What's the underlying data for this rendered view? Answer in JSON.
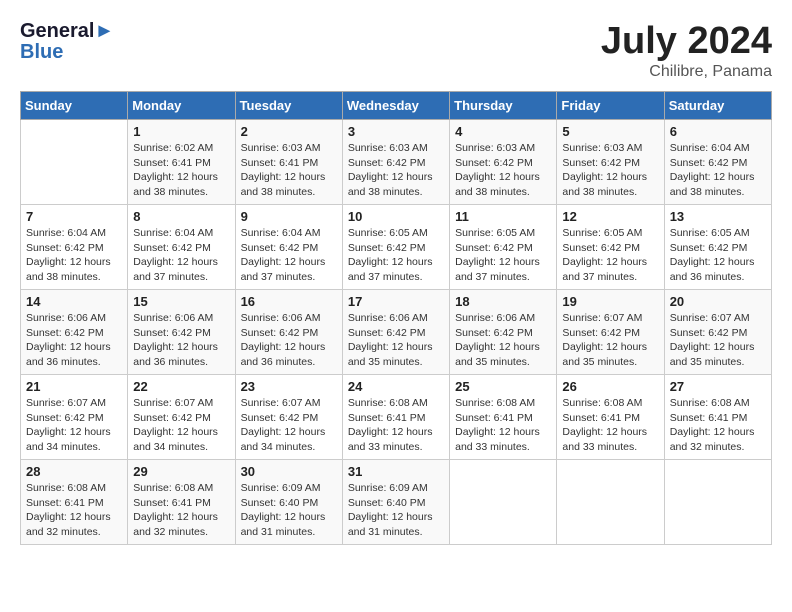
{
  "header": {
    "logo_line1": "General",
    "logo_line2": "Blue",
    "month": "July 2024",
    "location": "Chilibre, Panama"
  },
  "days_of_week": [
    "Sunday",
    "Monday",
    "Tuesday",
    "Wednesday",
    "Thursday",
    "Friday",
    "Saturday"
  ],
  "weeks": [
    [
      {
        "day": "",
        "sunrise": "",
        "sunset": "",
        "daylight": ""
      },
      {
        "day": "1",
        "sunrise": "6:02 AM",
        "sunset": "6:41 PM",
        "daylight": "12 hours and 38 minutes."
      },
      {
        "day": "2",
        "sunrise": "6:03 AM",
        "sunset": "6:41 PM",
        "daylight": "12 hours and 38 minutes."
      },
      {
        "day": "3",
        "sunrise": "6:03 AM",
        "sunset": "6:42 PM",
        "daylight": "12 hours and 38 minutes."
      },
      {
        "day": "4",
        "sunrise": "6:03 AM",
        "sunset": "6:42 PM",
        "daylight": "12 hours and 38 minutes."
      },
      {
        "day": "5",
        "sunrise": "6:03 AM",
        "sunset": "6:42 PM",
        "daylight": "12 hours and 38 minutes."
      },
      {
        "day": "6",
        "sunrise": "6:04 AM",
        "sunset": "6:42 PM",
        "daylight": "12 hours and 38 minutes."
      }
    ],
    [
      {
        "day": "7",
        "sunrise": "6:04 AM",
        "sunset": "6:42 PM",
        "daylight": "12 hours and 38 minutes."
      },
      {
        "day": "8",
        "sunrise": "6:04 AM",
        "sunset": "6:42 PM",
        "daylight": "12 hours and 37 minutes."
      },
      {
        "day": "9",
        "sunrise": "6:04 AM",
        "sunset": "6:42 PM",
        "daylight": "12 hours and 37 minutes."
      },
      {
        "day": "10",
        "sunrise": "6:05 AM",
        "sunset": "6:42 PM",
        "daylight": "12 hours and 37 minutes."
      },
      {
        "day": "11",
        "sunrise": "6:05 AM",
        "sunset": "6:42 PM",
        "daylight": "12 hours and 37 minutes."
      },
      {
        "day": "12",
        "sunrise": "6:05 AM",
        "sunset": "6:42 PM",
        "daylight": "12 hours and 37 minutes."
      },
      {
        "day": "13",
        "sunrise": "6:05 AM",
        "sunset": "6:42 PM",
        "daylight": "12 hours and 36 minutes."
      }
    ],
    [
      {
        "day": "14",
        "sunrise": "6:06 AM",
        "sunset": "6:42 PM",
        "daylight": "12 hours and 36 minutes."
      },
      {
        "day": "15",
        "sunrise": "6:06 AM",
        "sunset": "6:42 PM",
        "daylight": "12 hours and 36 minutes."
      },
      {
        "day": "16",
        "sunrise": "6:06 AM",
        "sunset": "6:42 PM",
        "daylight": "12 hours and 36 minutes."
      },
      {
        "day": "17",
        "sunrise": "6:06 AM",
        "sunset": "6:42 PM",
        "daylight": "12 hours and 35 minutes."
      },
      {
        "day": "18",
        "sunrise": "6:06 AM",
        "sunset": "6:42 PM",
        "daylight": "12 hours and 35 minutes."
      },
      {
        "day": "19",
        "sunrise": "6:07 AM",
        "sunset": "6:42 PM",
        "daylight": "12 hours and 35 minutes."
      },
      {
        "day": "20",
        "sunrise": "6:07 AM",
        "sunset": "6:42 PM",
        "daylight": "12 hours and 35 minutes."
      }
    ],
    [
      {
        "day": "21",
        "sunrise": "6:07 AM",
        "sunset": "6:42 PM",
        "daylight": "12 hours and 34 minutes."
      },
      {
        "day": "22",
        "sunrise": "6:07 AM",
        "sunset": "6:42 PM",
        "daylight": "12 hours and 34 minutes."
      },
      {
        "day": "23",
        "sunrise": "6:07 AM",
        "sunset": "6:42 PM",
        "daylight": "12 hours and 34 minutes."
      },
      {
        "day": "24",
        "sunrise": "6:08 AM",
        "sunset": "6:41 PM",
        "daylight": "12 hours and 33 minutes."
      },
      {
        "day": "25",
        "sunrise": "6:08 AM",
        "sunset": "6:41 PM",
        "daylight": "12 hours and 33 minutes."
      },
      {
        "day": "26",
        "sunrise": "6:08 AM",
        "sunset": "6:41 PM",
        "daylight": "12 hours and 33 minutes."
      },
      {
        "day": "27",
        "sunrise": "6:08 AM",
        "sunset": "6:41 PM",
        "daylight": "12 hours and 32 minutes."
      }
    ],
    [
      {
        "day": "28",
        "sunrise": "6:08 AM",
        "sunset": "6:41 PM",
        "daylight": "12 hours and 32 minutes."
      },
      {
        "day": "29",
        "sunrise": "6:08 AM",
        "sunset": "6:41 PM",
        "daylight": "12 hours and 32 minutes."
      },
      {
        "day": "30",
        "sunrise": "6:09 AM",
        "sunset": "6:40 PM",
        "daylight": "12 hours and 31 minutes."
      },
      {
        "day": "31",
        "sunrise": "6:09 AM",
        "sunset": "6:40 PM",
        "daylight": "12 hours and 31 minutes."
      },
      {
        "day": "",
        "sunrise": "",
        "sunset": "",
        "daylight": ""
      },
      {
        "day": "",
        "sunrise": "",
        "sunset": "",
        "daylight": ""
      },
      {
        "day": "",
        "sunrise": "",
        "sunset": "",
        "daylight": ""
      }
    ]
  ]
}
